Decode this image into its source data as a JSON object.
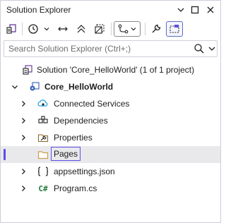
{
  "window": {
    "title": "Solution Explorer"
  },
  "search": {
    "placeholder": "Search Solution Explorer (Ctrl+;)",
    "value": ""
  },
  "tree": {
    "solution": "Solution 'Core_HelloWorld' (1 of 1 project)",
    "project": "Core_HelloWorld",
    "items": [
      {
        "label": "Connected Services",
        "icon": "connected-services-icon"
      },
      {
        "label": "Dependencies",
        "icon": "dependencies-icon"
      },
      {
        "label": "Properties",
        "icon": "wrench-folder-icon"
      },
      {
        "label": "Pages",
        "icon": "folder-icon",
        "selected": true
      },
      {
        "label": "appsettings.json",
        "icon": "json-file-icon"
      },
      {
        "label": "Program.cs",
        "icon": "csharp-file-icon"
      }
    ],
    "csharp_glyph": "C#"
  },
  "colors": {
    "accent": "#5c4ee5",
    "selection_bg": "#e9e9ec",
    "folder": "#dcb67a",
    "csharp": "#1f7a3a",
    "border": "#cccedb"
  }
}
